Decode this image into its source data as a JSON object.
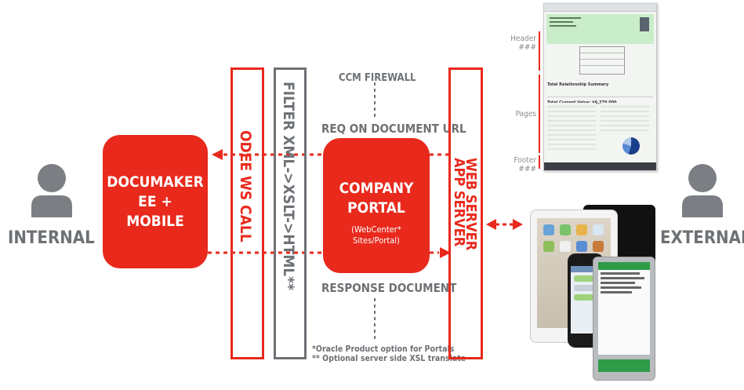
{
  "actors": {
    "internal": "INTERNAL",
    "external": "EXTERNAL"
  },
  "boxes": {
    "documaker": [
      "DOCUMAKER",
      "EE +",
      "MOBILE"
    ],
    "portal_title": [
      "COMPANY",
      "PORTAL"
    ],
    "portal_sub": [
      "(WebCenter*",
      "Sites/Portal)"
    ]
  },
  "bars": {
    "odee": "ODEE WS CALL",
    "filter": "FILTER XML->XSLT->HTML**",
    "web_server": "WEB SERVER",
    "app_server": "APP SERVER"
  },
  "labels": {
    "firewall": "CCM FIREWALL",
    "request": "REQ ON DOCUMENT URL",
    "response": "RESPONSE DOCUMENT"
  },
  "notes": {
    "note1": "*Oracle Product option for Portals",
    "note2": "** Optional server side XSL translate"
  },
  "document_preview": {
    "header": "Header",
    "header_sub": "###",
    "pages": "Pages",
    "footer": "Footer",
    "footer_sub": "###",
    "summary_title": "Total Relationship Summary",
    "total_label": "Total Current Value: $6,779,000"
  },
  "colors": {
    "accent_red": "#e8291c",
    "gray": "#6d7175",
    "person_gray": "#7b7e82"
  }
}
